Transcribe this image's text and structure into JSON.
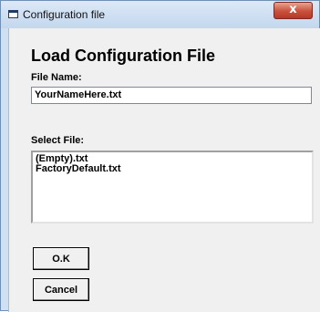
{
  "window": {
    "title": "Configuration file",
    "close_glyph": "x"
  },
  "dialog": {
    "heading": "Load Configuration File",
    "file_name_label": "File Name:",
    "file_name_value": "YourNameHere.txt",
    "select_file_label": "Select File:",
    "files": [
      "(Empty).txt",
      "FactoryDefault.txt"
    ],
    "ok_label": "O.K",
    "cancel_label": "Cancel"
  },
  "icons": {
    "window_icon": "window-icon",
    "close_icon": "close-icon"
  }
}
